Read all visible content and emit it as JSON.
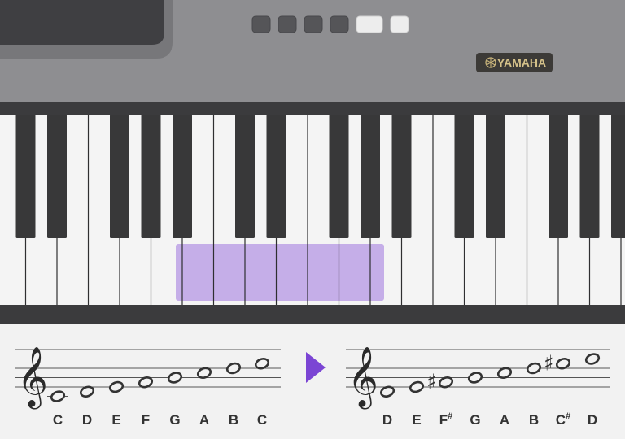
{
  "brand": {
    "logo_text": "YAMAHA",
    "logo_icon": "tuning-fork-emblem-icon"
  },
  "panel": {
    "buttons": 6,
    "lit_buttons": [
      5,
      6
    ]
  },
  "keyboard": {
    "highlight_color": "#c5aee8"
  },
  "left_staff": {
    "clef": "treble-clef-icon",
    "notes": [
      "C",
      "D",
      "E",
      "F",
      "G",
      "A",
      "B",
      "C"
    ]
  },
  "arrow": {
    "icon": "play-arrow-icon",
    "color": "#7b45d4"
  },
  "right_staff": {
    "clef": "treble-clef-icon",
    "notes": [
      "D",
      "E",
      "F#",
      "G",
      "A",
      "B",
      "C#",
      "D"
    ],
    "labels": [
      {
        "base": "D",
        "sup": ""
      },
      {
        "base": "E",
        "sup": ""
      },
      {
        "base": "F",
        "sup": "#"
      },
      {
        "base": "G",
        "sup": ""
      },
      {
        "base": "A",
        "sup": ""
      },
      {
        "base": "B",
        "sup": ""
      },
      {
        "base": "C",
        "sup": "#"
      },
      {
        "base": "D",
        "sup": ""
      }
    ]
  }
}
